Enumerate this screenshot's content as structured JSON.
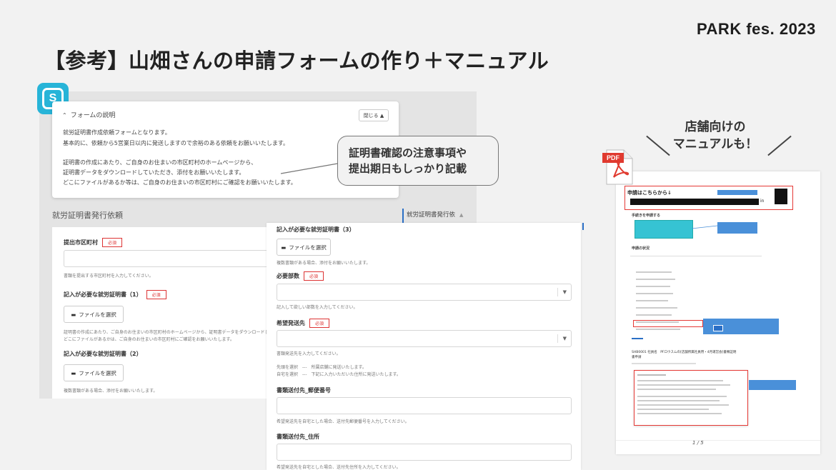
{
  "brand": "PARK fes. 2023",
  "slide_title": "【参考】山畑さんの申請フォームの作り＋マニュアル",
  "app_icon": {
    "name": "spir-logo",
    "glyph": "S",
    "color": "#27b4d8"
  },
  "description_card": {
    "heading": "フォームの説明",
    "close_button": "閉じる ▲",
    "lines": [
      "就労証明書作成依頼フォームとなります。",
      "基本的に、依頼から5営業日以内に発送しますので余裕のある依頼をお願いいたします。",
      "",
      "証明書の作成にあたり、ご自身のお住まいの市区町村のホームページから、",
      "証明書データをダウンロードしていただき、添付をお願いいたします。",
      "どこにファイルがあるか等は、ご自身のお住まいの市区町村にご確認をお願いいたします。"
    ]
  },
  "callout": {
    "line1": "証明書確認の注意事項や",
    "line2": "提出期日もしっかり記載"
  },
  "left_form": {
    "title": "就労証明書発行依頼",
    "side_nav": "就労証明書発行依",
    "fields": {
      "municipality": {
        "label": "提出市区町村",
        "hint": "書類を提出する市区町村を入力してください。"
      },
      "cert1": {
        "label": "記入が必要な就労証明書（1）",
        "hint1": "証明書の作成にあたり、ご自身のお住まいの市区町村のホームページから、証明書データをダウンロードし",
        "hint2": "どこにファイルがあるかは、ご自身のお住まいの市区町村にご確認をお願いいたします。"
      },
      "cert2": {
        "label": "記入が必要な就労証明書（2）",
        "hint": "複数書類がある場合、添付をお願いいたします。"
      }
    }
  },
  "mid_form": {
    "cert3": {
      "label": "記入が必要な就労証明書（3）",
      "hint": "複数書類がある場合、添付をお願いいたします。"
    },
    "copies": {
      "label": "必要部数",
      "hint": "記入して欲しい部数を入力してください。"
    },
    "destination": {
      "label": "希望発送先",
      "hint": "書類発送先を入力してください。",
      "option1": "先頭を選択　---　所属店舗に発送いたします。",
      "option2": "自宅を選択　---　下記に入力いただいた住所に発送いたします。"
    },
    "postal": {
      "label": "書類送付先_郵便番号",
      "hint": "希望発送先を自宅とした場合、送付先郵便番号を入力してください。"
    },
    "address": {
      "label": "書類送付先_住所",
      "hint": "希望発送先を自宅とした場合、送付先住所を入力してください。"
    }
  },
  "required_badge": "必須",
  "file_button": "ファイルを選択",
  "manual_section": {
    "title_line1": "店舗向けの",
    "title_line2": "マニュアルも！",
    "pdf_label": "PDF",
    "header_text": "申請はこちらから↓",
    "in_text": "in",
    "section1": "手続きを申請する",
    "section2": "申請の状況",
    "doc_title": "SHB0001 社員名　PFロウスムの[店舗所属社員用・4月運営会]書類証明書申請",
    "page_num": "1 / 5"
  },
  "colors": {
    "accent": "#2a6fc6",
    "required": "#dd3333",
    "teal": "#36c3d3",
    "callout_border": "#777777"
  }
}
